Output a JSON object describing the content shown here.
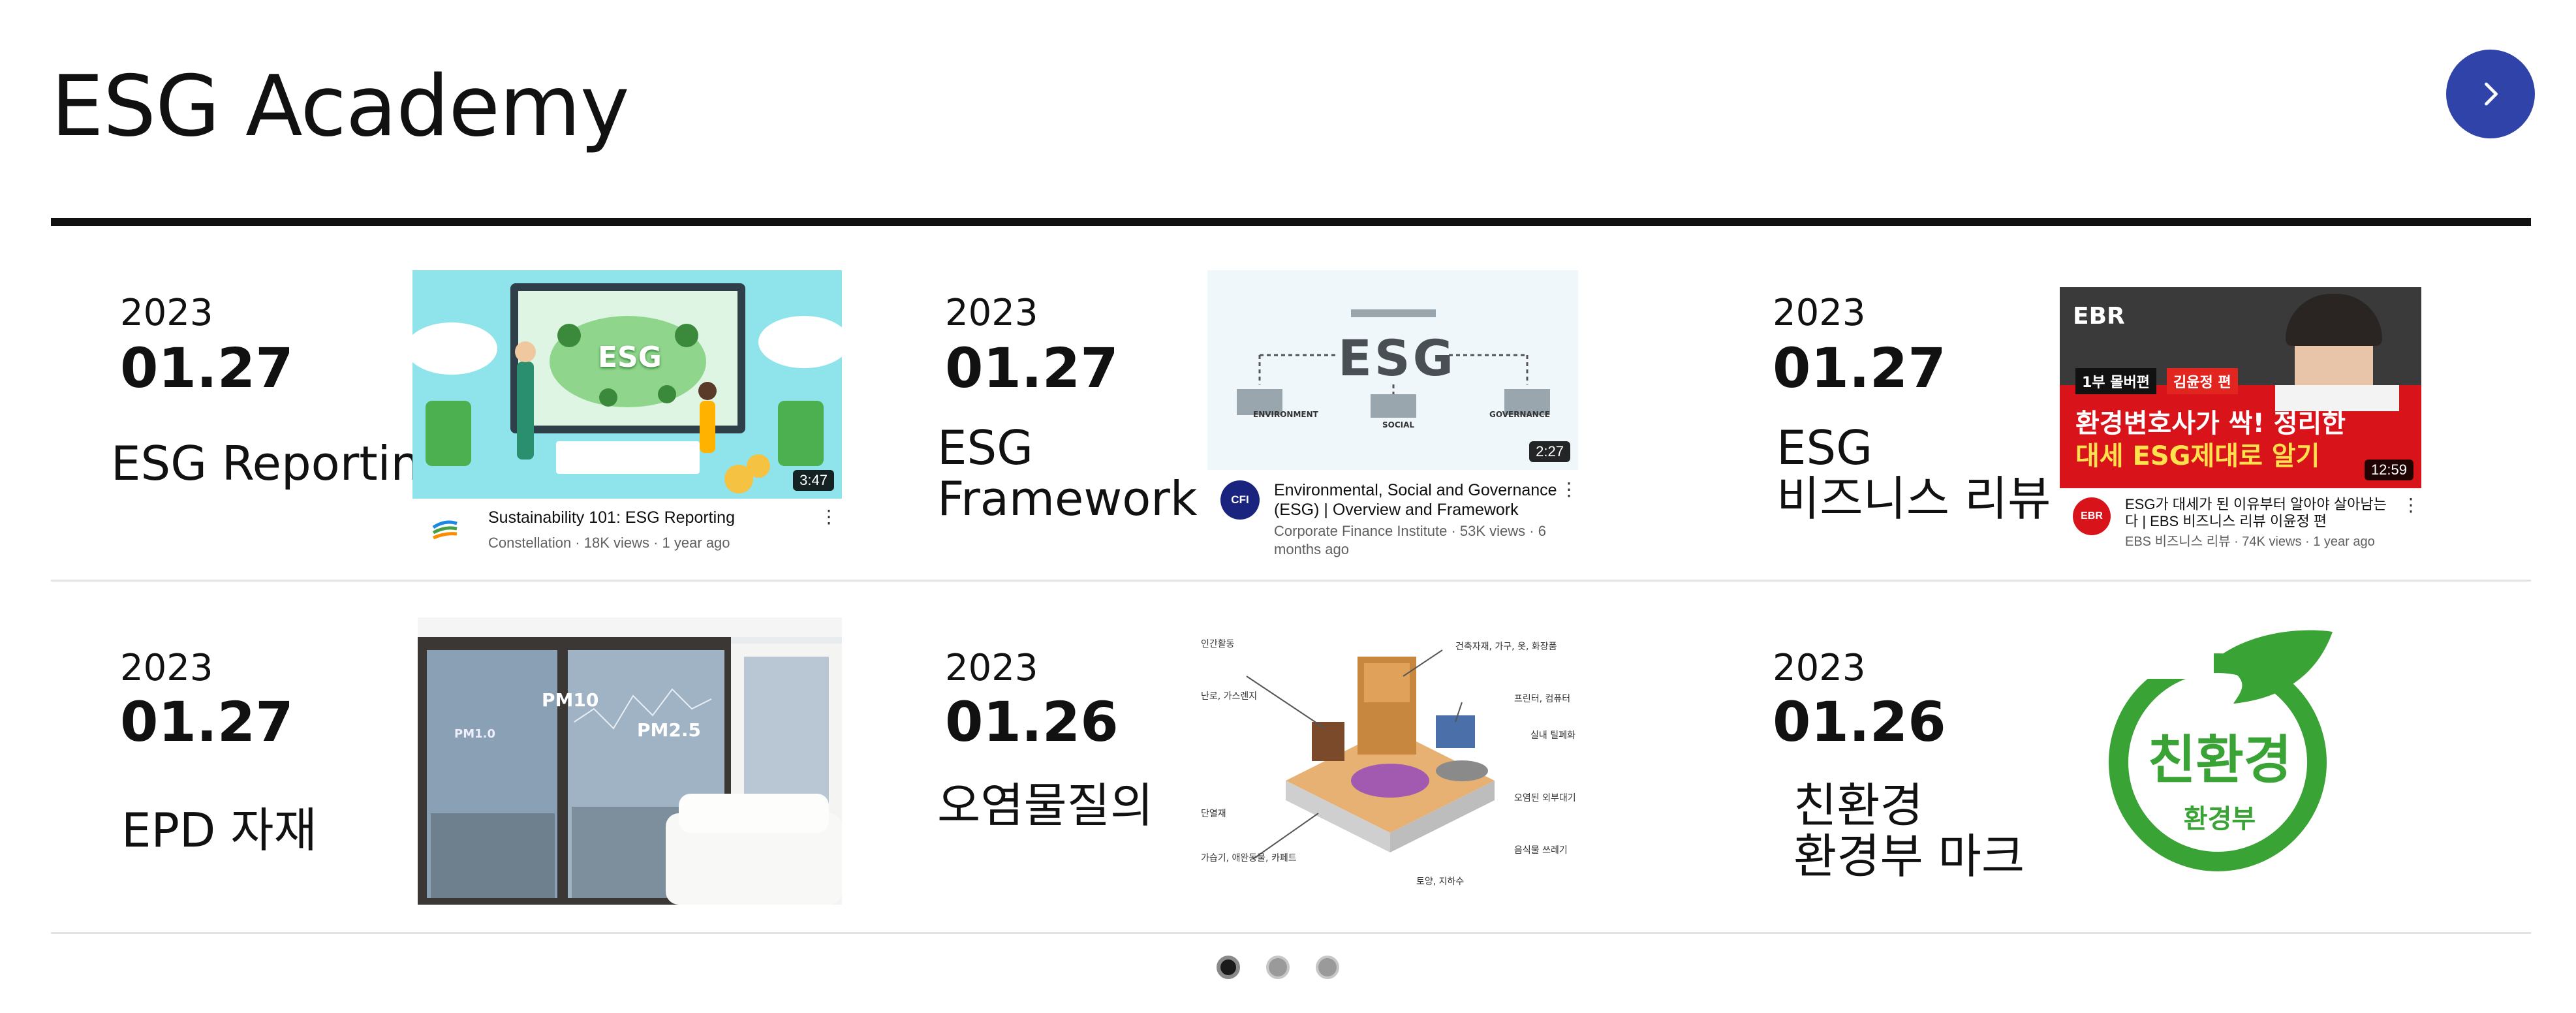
{
  "section": {
    "title": "ESG Academy"
  },
  "nav": {
    "next_icon": "chevron-right-icon",
    "accent": "#2f43a8"
  },
  "cards": [
    {
      "year": "2023",
      "date": "01.27",
      "label": "ESG Reporting",
      "video": {
        "title": "Sustainability 101: ESG Reporting",
        "meta": "Constellation · 18K views · 1 year ago",
        "duration": "3:47",
        "thumb_text": "ESG"
      }
    },
    {
      "year": "2023",
      "date": "01.27",
      "label": "ESG\nFramework",
      "video": {
        "title_line1": "Environmental, Social and Governance",
        "title_line2": "(ESG) | Overview and Framework",
        "meta_line1": "Corporate Finance Institute · 53K views · 6",
        "meta_line2": "months ago",
        "duration": "2:27",
        "thumb_text": "ESG",
        "avatar_text": "CFI",
        "col_labels": [
          "ENVIRONMENT",
          "SOCIAL",
          "GOVERNANCE"
        ]
      }
    },
    {
      "year": "2023",
      "date": "01.27",
      "label": "ESG\n비즈니스 리뷰",
      "video": {
        "title_line1": "ESG가 대세가 된 이유부터 알아야 살아남는",
        "title_line2": "다 | EBS 비즈니스 리뷰 이윤정 편",
        "meta": "EBS 비즈니스 리뷰 · 74K views · 1 year ago",
        "duration": "12:59",
        "brand": "EBR",
        "badge_left": "1부 몰버편",
        "badge_right": "김윤정 편",
        "headline1": "환경변호사가 싹! 정리한",
        "headline2": "대세 ESG제대로 알기",
        "avatar_text": "EBR"
      }
    },
    {
      "year": "2023",
      "date": "01.27",
      "label": "EPD 자재",
      "thumb": {
        "pm10": "PM10",
        "pm25": "PM2.5",
        "pm_small": "PM1.0"
      }
    },
    {
      "year": "2023",
      "date": "01.26",
      "label": "오염물질의",
      "thumb": {
        "annotations": [
          "인간활동",
          "건축자재, 가구, 옷, 화장품",
          "난로, 가스렌지",
          "프린터, 컴퓨터",
          "실내 틸폐화",
          "오염된 외부대기",
          "음식물 쓰레기",
          "가습기, 애완동물, 카페트",
          "토양, 지하수",
          "단열재"
        ]
      }
    },
    {
      "year": "2023",
      "date": "01.26",
      "label": "친환경\n환경부 마크",
      "logo": {
        "line1": "친환경",
        "line2": "환경부",
        "color": "#3aa335"
      }
    }
  ],
  "pagination": {
    "count": 3,
    "active": 0
  }
}
